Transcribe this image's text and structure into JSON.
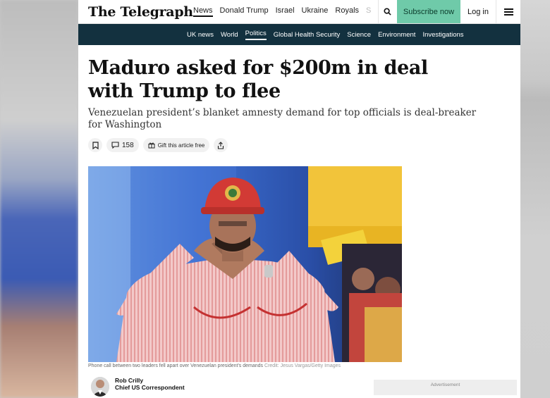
{
  "header": {
    "logo": "The Telegraph",
    "nav": [
      "News",
      "Donald Trump",
      "Israel",
      "Ukraine",
      "Royals",
      "S"
    ],
    "subscribe_label": "Subscribe now",
    "login_label": "Log in"
  },
  "sections": [
    "UK news",
    "World",
    "Politics",
    "Global Health Security",
    "Science",
    "Environment",
    "Investigations"
  ],
  "article": {
    "headline": "Maduro asked for $200m in deal with Trump to flee",
    "standfirst": "Venezuelan president’s blanket amnesty demand for top officials is deal-breaker for Washington",
    "comment_count": "158",
    "gift_label": "Gift this article free",
    "caption": "Phone call between two leaders fell apart over Venezuelan president's demands",
    "credit": "Credit: Jesus Vargas/Getty Images",
    "author_name": "Rob Crilly",
    "author_role": "Chief US Correspondent",
    "ad_label": "Advertisement"
  },
  "icons": {
    "search": "search-icon",
    "menu": "menu-icon",
    "bookmark": "bookmark-icon",
    "comment": "comment-icon",
    "gift": "gift-icon",
    "share": "share-icon"
  },
  "colors": {
    "subscribe_bg": "#6fcaa9",
    "section_bar_bg": "#13313f"
  }
}
